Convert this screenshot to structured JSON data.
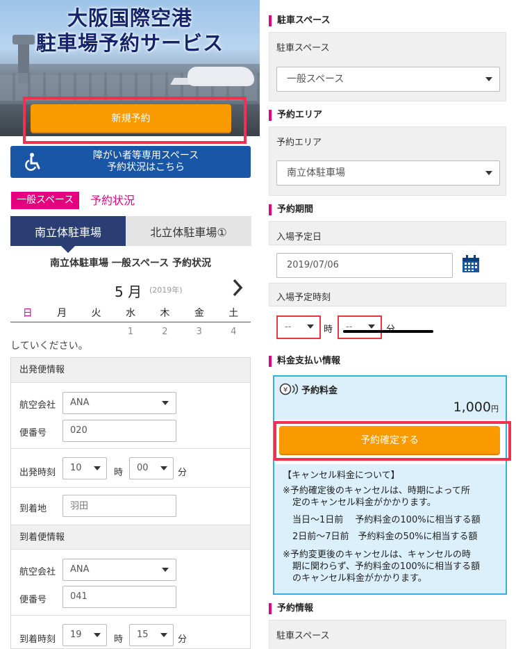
{
  "hero": {
    "title_line1": "大阪国際空港",
    "title_line2": "駐車場予約サービス",
    "new_reservation": "新規予約"
  },
  "accessible": {
    "line1": "障がい者等専用スペース",
    "line2": "予約状況はこちら"
  },
  "status": {
    "space_tag": "一般スペース",
    "label": "予約状況"
  },
  "tabs": [
    {
      "label": "南立体駐車場",
      "active": true
    },
    {
      "label": "北立体駐車場①",
      "active": false
    }
  ],
  "calendar": {
    "caption": "南立体駐車場 一般スペース 予約状況",
    "month": "5 月",
    "year": "(2019年)",
    "weekdays": [
      "日",
      "月",
      "火",
      "水",
      "木",
      "金",
      "土"
    ],
    "first_row": [
      "",
      "",
      "",
      "1",
      "2",
      "3",
      "4"
    ],
    "cut_text": "していください。"
  },
  "departure": {
    "header": "出発便情報",
    "airline_label": "航空会社",
    "airline_value": "ANA",
    "flight_label": "便番号",
    "flight_value": "020",
    "time_label": "出発時刻",
    "hour": "10",
    "minute": "00",
    "hour_unit": "時",
    "minute_unit": "分",
    "dest_label": "到着地",
    "dest_placeholder": "羽田"
  },
  "arrival": {
    "header": "到着便情報",
    "airline_label": "航空会社",
    "airline_value": "ANA",
    "flight_label": "便番号",
    "flight_value": "041",
    "time_label": "到着時刻",
    "hour": "19",
    "minute": "15",
    "hour_unit": "時",
    "minute_unit": "分"
  },
  "right": {
    "parking_space_head": "駐車スペース",
    "parking_space_label": "駐車スペース",
    "parking_space_value": "一般スペース",
    "area_head": "予約エリア",
    "area_label": "予約エリア",
    "area_value": "南立体駐車場",
    "period_head": "予約期間",
    "entry_date_label": "入場予定日",
    "entry_date_value": "2019/07/06",
    "entry_time_label": "入場予定時刻",
    "hour_value": "--",
    "minute_value": "--",
    "hour_unit": "時",
    "minute_unit": "分",
    "fee_head": "料金支払い情報",
    "fee_label": "予約料金",
    "fee_amount": "1,000",
    "fee_currency": "円",
    "confirm_button": "予約確定する",
    "cancel_title": "【キャンセル料金について】",
    "cancel_note1_a": "※予約確定後のキャンセルは、時期によって所",
    "cancel_note1_b": "定のキャンセル料金がかかります。",
    "cancel_row1": "当日〜1日前　 予約料金の100%に相当する額",
    "cancel_row2": "2日前〜7日前　予約料金の50%に相当する額",
    "cancel_note2_a": "※予約変更後のキャンセルは、キャンセルの時",
    "cancel_note2_b": "期に関わらず、予約料金の100%に相当する額",
    "cancel_note2_c": "のキャンセル料金がかかります。",
    "info_head": "予約情報",
    "info_label": "駐車スペース"
  },
  "colors": {
    "accent_pink": "#e4007f",
    "button_orange": "#f99a00",
    "highlight_red": "#f0314f",
    "navy": "#2b3e73",
    "accessible_blue": "#1a56a6",
    "fee_blue": "#36aee2"
  }
}
